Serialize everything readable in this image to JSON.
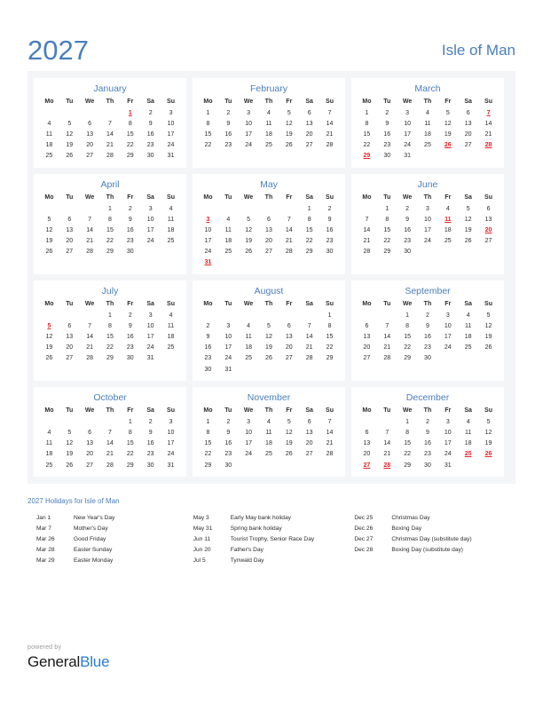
{
  "header": {
    "year": "2027",
    "country": "Isle of Man"
  },
  "weekday_headers": [
    "Mo",
    "Tu",
    "We",
    "Th",
    "Fr",
    "Sa",
    "Su"
  ],
  "colors": {
    "accent_blue": "#4a7ebb",
    "holiday_red": "#ee1c25",
    "panel_background": "#f4f5f7",
    "card_background": "#ffffff",
    "text": "#2b2b2b",
    "brand_blue": "#2b7cd3"
  },
  "months": [
    {
      "name": "January",
      "first_weekday_index": 4,
      "days_in_month": 31,
      "holidays": [
        1
      ]
    },
    {
      "name": "February",
      "first_weekday_index": 0,
      "days_in_month": 28,
      "holidays": []
    },
    {
      "name": "March",
      "first_weekday_index": 0,
      "days_in_month": 31,
      "holidays": [
        7,
        26,
        28,
        29
      ]
    },
    {
      "name": "April",
      "first_weekday_index": 3,
      "days_in_month": 30,
      "holidays": []
    },
    {
      "name": "May",
      "first_weekday_index": 5,
      "days_in_month": 31,
      "holidays": [
        3,
        31
      ]
    },
    {
      "name": "June",
      "first_weekday_index": 1,
      "days_in_month": 30,
      "holidays": [
        11,
        20
      ]
    },
    {
      "name": "July",
      "first_weekday_index": 3,
      "days_in_month": 31,
      "holidays": [
        5
      ]
    },
    {
      "name": "August",
      "first_weekday_index": 6,
      "days_in_month": 31,
      "holidays": []
    },
    {
      "name": "September",
      "first_weekday_index": 2,
      "days_in_month": 30,
      "holidays": []
    },
    {
      "name": "October",
      "first_weekday_index": 4,
      "days_in_month": 31,
      "holidays": []
    },
    {
      "name": "November",
      "first_weekday_index": 0,
      "days_in_month": 30,
      "holidays": []
    },
    {
      "name": "December",
      "first_weekday_index": 2,
      "days_in_month": 31,
      "holidays": [
        25,
        26,
        27,
        28
      ]
    }
  ],
  "holidays_section": {
    "title": "2027 Holidays for Isle of Man",
    "columns": [
      [
        {
          "date": "Jan 1",
          "name": "New Year's Day"
        },
        {
          "date": "Mar 7",
          "name": "Mother's Day"
        },
        {
          "date": "Mar 26",
          "name": "Good Friday"
        },
        {
          "date": "Mar 28",
          "name": "Easter Sunday"
        },
        {
          "date": "Mar 29",
          "name": "Easter Monday"
        }
      ],
      [
        {
          "date": "May 3",
          "name": "Early May bank holiday"
        },
        {
          "date": "May 31",
          "name": "Spring bank holiday"
        },
        {
          "date": "Jun 11",
          "name": "Tourist Trophy, Senior Race Day"
        },
        {
          "date": "Jun 20",
          "name": "Father's Day"
        },
        {
          "date": "Jul 5",
          "name": "Tynwald Day"
        }
      ],
      [
        {
          "date": "Dec 25",
          "name": "Christmas Day"
        },
        {
          "date": "Dec 26",
          "name": "Boxing Day"
        },
        {
          "date": "Dec 27",
          "name": "Christmas Day (substitute day)"
        },
        {
          "date": "Dec 28",
          "name": "Boxing Day (substitute day)"
        }
      ]
    ]
  },
  "footer": {
    "powered_by": "powered by",
    "brand_part_1": "General",
    "brand_part_2": "Blue"
  }
}
